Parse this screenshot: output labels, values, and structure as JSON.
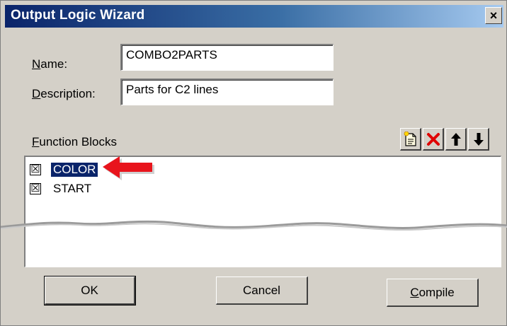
{
  "dialog": {
    "title": "Output Logic Wizard",
    "close_label": "×"
  },
  "form": {
    "name_label_mnemonic": "N",
    "name_label_rest": "ame:",
    "name_value": "COMBO2PARTS",
    "description_label_mnemonic": "D",
    "description_label_rest": "escription:",
    "description_value": "Parts for C2 lines"
  },
  "function_blocks": {
    "label_mnemonic": "F",
    "label_rest": "unction Blocks",
    "toolbar": [
      {
        "icon": "new-document-icon"
      },
      {
        "icon": "delete-x-icon",
        "color": "#e00000"
      },
      {
        "icon": "arrow-up-icon",
        "glyph": "🡑"
      },
      {
        "icon": "arrow-down-icon",
        "glyph": "🡓"
      }
    ],
    "items": [
      {
        "label": "COLOR",
        "checked": true,
        "selected": true
      },
      {
        "label": "START",
        "checked": true,
        "selected": false
      }
    ],
    "checkbox_glyph": "☒"
  },
  "annotation": {
    "arrow_color": "#e8141c"
  },
  "buttons": {
    "ok_label": "OK",
    "cancel_label": "Cancel",
    "compile_mnemonic": "C",
    "compile_rest": "ompile"
  }
}
